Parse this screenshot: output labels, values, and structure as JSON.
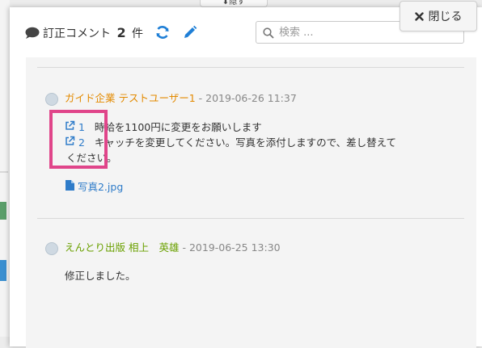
{
  "top_tab": {
    "label": "⬇隠す"
  },
  "header": {
    "title": "訂正コメント",
    "count": "2",
    "count_unit": "件"
  },
  "search": {
    "placeholder": "検索 ..."
  },
  "close_button": {
    "label": "閉じる"
  },
  "comments": [
    {
      "author": "ガイド企業 テストユーザー1",
      "separator": " - ",
      "date": "2019-06-26 11:37",
      "author_color": "#e38a00",
      "lines": [
        {
          "ref": "1",
          "text": "時給を1100円に変更をお願いします"
        },
        {
          "ref": "2",
          "text": "キャッチを変更してください。写真を添付しますので、差し替えて"
        }
      ],
      "wrap": "ください。",
      "attachment": "写真2.jpg"
    },
    {
      "author": "えんとり出版 相上　英雄",
      "separator": " - ",
      "date": "2019-06-25 13:30",
      "author_color": "#6aa000",
      "body": "修正しました。"
    }
  ],
  "colors": {
    "link": "#2f7cc9",
    "highlight": "#e0458a",
    "panel_bg": "#f4f4f4"
  }
}
